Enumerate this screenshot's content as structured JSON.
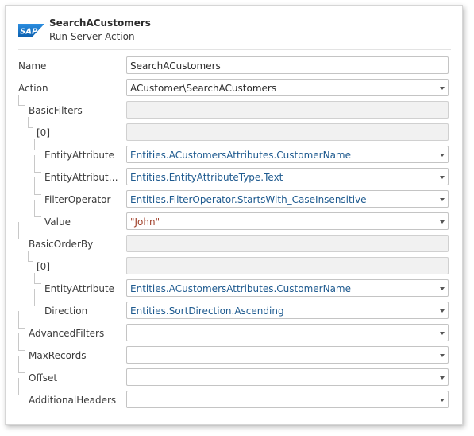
{
  "header": {
    "logo_text": "SAP",
    "title": "SearchACustomers",
    "subtitle": "Run Server Action"
  },
  "rows": [
    {
      "label": "Name",
      "value": "SearchACustomers",
      "kind": "plain",
      "dropdown": false
    },
    {
      "label": "Action",
      "value": "ACustomer\\SearchACustomers",
      "kind": "plain",
      "dropdown": true
    },
    {
      "label": "BasicFilters",
      "value": "",
      "kind": "readonly",
      "dropdown": false
    },
    {
      "label": "[0]",
      "value": "",
      "kind": "readonly",
      "dropdown": false
    },
    {
      "label": "EntityAttribute",
      "value": "Entities.ACustomersAttributes.CustomerName",
      "kind": "expr",
      "dropdown": true
    },
    {
      "label": "EntityAttributeT...",
      "value": "Entities.EntityAttributeType.Text",
      "kind": "expr",
      "dropdown": true
    },
    {
      "label": "FilterOperator",
      "value": "Entities.FilterOperator.StartsWith_CaseInsensitive",
      "kind": "expr",
      "dropdown": true
    },
    {
      "label": "Value",
      "value": "\"John\"",
      "kind": "str",
      "dropdown": true
    },
    {
      "label": "BasicOrderBy",
      "value": "",
      "kind": "readonly",
      "dropdown": false
    },
    {
      "label": "[0]",
      "value": "",
      "kind": "readonly",
      "dropdown": false
    },
    {
      "label": "EntityAttribute",
      "value": "Entities.ACustomersAttributes.CustomerName",
      "kind": "expr",
      "dropdown": true
    },
    {
      "label": "Direction",
      "value": "Entities.SortDirection.Ascending",
      "kind": "expr",
      "dropdown": true
    },
    {
      "label": "AdvancedFilters",
      "value": "",
      "kind": "plain",
      "dropdown": true
    },
    {
      "label": "MaxRecords",
      "value": "",
      "kind": "plain",
      "dropdown": true
    },
    {
      "label": "Offset",
      "value": "",
      "kind": "plain",
      "dropdown": true
    },
    {
      "label": "AdditionalHeaders",
      "value": "",
      "kind": "plain",
      "dropdown": true
    }
  ],
  "colors": {
    "expression": "#1e5a8f",
    "string_literal": "#a0402a",
    "logo_blue": "#1a73c9"
  }
}
